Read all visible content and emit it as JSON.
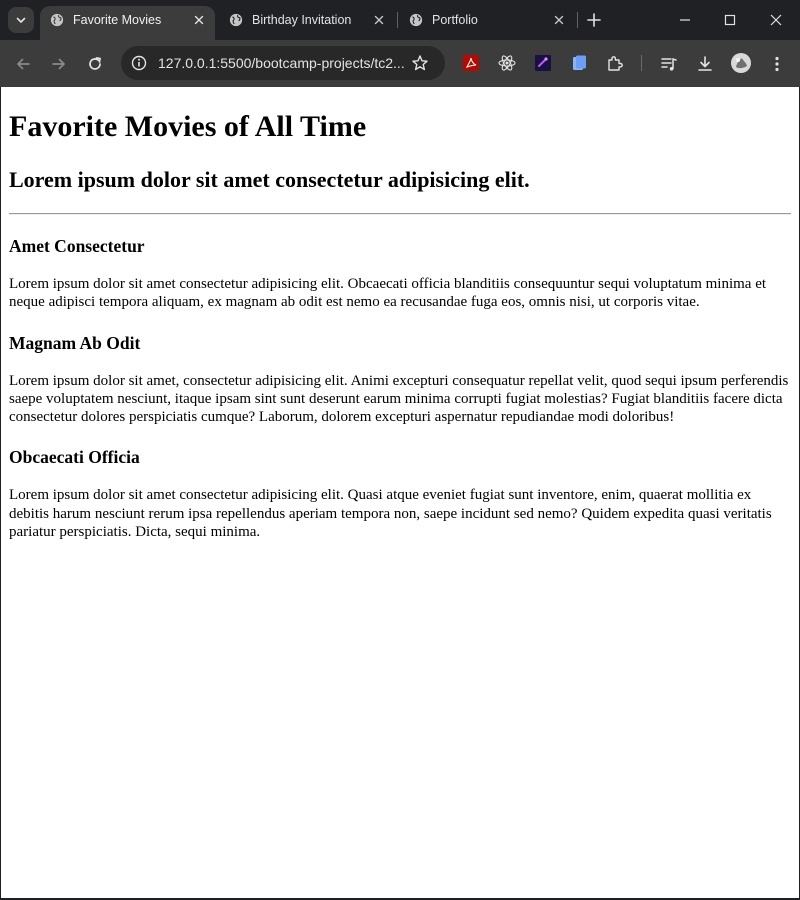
{
  "browser": {
    "tabs": [
      {
        "title": "Favorite Movies",
        "active": true
      },
      {
        "title": "Birthday Invitation",
        "active": false
      },
      {
        "title": "Portfolio",
        "active": false
      }
    ],
    "address": "127.0.0.1:5500/bootcamp-projects/tc2...",
    "extensions": [
      "adobe-acrobat-icon",
      "react-devtools-icon",
      "purple-extension-icon",
      "google-docs-icon",
      "extensions-puzzle-icon"
    ],
    "colors": {
      "frame": "#202124",
      "toolbar": "#3c3c3c",
      "omnibox": "#282828",
      "text": "#e3e3e3"
    }
  },
  "page": {
    "title": "Favorite Movies of All Time",
    "subtitle": "Lorem ipsum dolor sit amet consectetur adipisicing elit.",
    "sections": [
      {
        "heading": "Amet Consectetur",
        "body": "Lorem ipsum dolor sit amet consectetur adipisicing elit. Obcaecati officia blanditiis consequuntur sequi voluptatum minima et neque adipisci tempora aliquam, ex magnam ab odit est nemo ea recusandae fuga eos, omnis nisi, ut corporis vitae."
      },
      {
        "heading": "Magnam Ab Odit",
        "body": "Lorem ipsum dolor sit amet, consectetur adipisicing elit. Animi excepturi consequatur repellat velit, quod sequi ipsum perferendis saepe voluptatem nesciunt, itaque ipsam sint sunt deserunt earum minima corrupti fugiat molestias? Fugiat blanditiis facere dicta consectetur dolores perspiciatis cumque? Laborum, dolorem excepturi aspernatur repudiandae modi doloribus!"
      },
      {
        "heading": "Obcaecati Officia",
        "body": "Lorem ipsum dolor sit amet consectetur adipisicing elit. Quasi atque eveniet fugiat sunt inventore, enim, quaerat mollitia ex debitis harum nesciunt rerum ipsa repellendus aperiam tempora non, saepe incidunt sed nemo? Quidem expedita quasi veritatis pariatur perspiciatis. Dicta, sequi minima."
      }
    ]
  }
}
